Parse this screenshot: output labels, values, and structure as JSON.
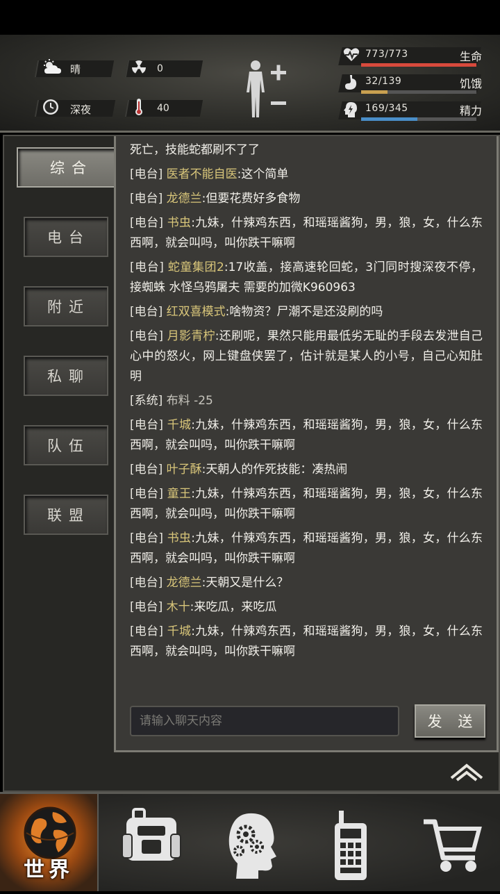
{
  "status": {
    "weather": "晴",
    "radiation": "0",
    "time_of_day": "深夜",
    "temperature": "40",
    "health": {
      "value": "773/773",
      "label": "生命",
      "ratio": 1.0,
      "color": "#d84a3c"
    },
    "hunger": {
      "value": "32/139",
      "label": "饥饿",
      "ratio": 0.23,
      "color": "#c8a050"
    },
    "energy": {
      "value": "169/345",
      "label": "精力",
      "ratio": 0.49,
      "color": "#4a8ec8"
    }
  },
  "tabs": [
    {
      "label": "综合",
      "active": true
    },
    {
      "label": "电台",
      "active": false
    },
    {
      "label": "附近",
      "active": false
    },
    {
      "label": "私聊",
      "active": false
    },
    {
      "label": "队伍",
      "active": false
    },
    {
      "label": "联盟",
      "active": false
    }
  ],
  "messages": [
    {
      "tag": "",
      "author": "",
      "text": "死亡，技能蛇都刷不了了",
      "system": false
    },
    {
      "tag": "[电台]",
      "author": "医者不能自医",
      "text": ":这个简单",
      "system": false
    },
    {
      "tag": "[电台]",
      "author": "龙德兰",
      "text": ":但要花费好多食物",
      "system": false
    },
    {
      "tag": "[电台]",
      "author": "书虫",
      "text": ":九妹，什辣鸡东西，和瑶瑶酱狗，男，狼，女，什么东西啊，就会叫吗，叫你跌干嘛啊",
      "system": false
    },
    {
      "tag": "[电台]",
      "author": "蛇童集团2",
      "text": ":17收盖，接高速轮回蛇，3门同时搜深夜不停，接蜘蛛 水怪乌鸦屠夫 需要的加微K960963",
      "system": false
    },
    {
      "tag": "[电台]",
      "author": "红双喜模式",
      "text": ":啥物资？尸潮不是还没刷的吗",
      "system": false
    },
    {
      "tag": "[电台]",
      "author": "月影青柠",
      "text": ":还刷呢，果然只能用最低劣无耻的手段去发泄自己心中的怒火，网上键盘侠罢了，估计就是某人的小号，自己心知肚明",
      "system": false
    },
    {
      "tag": "[系统]",
      "author": "",
      "text": "布料 -25",
      "system": true
    },
    {
      "tag": "[电台]",
      "author": "千城",
      "text": ":九妹，什辣鸡东西，和瑶瑶酱狗，男，狼，女，什么东西啊，就会叫吗，叫你跌干嘛啊",
      "system": false
    },
    {
      "tag": "[电台]",
      "author": "叶子酥",
      "text": ":天朝人的作死技能：凑热闹",
      "system": false
    },
    {
      "tag": "[电台]",
      "author": "童王",
      "text": ":九妹，什辣鸡东西，和瑶瑶酱狗，男，狼，女，什么东西啊，就会叫吗，叫你跌干嘛啊",
      "system": false
    },
    {
      "tag": "[电台]",
      "author": "书虫",
      "text": ":九妹，什辣鸡东西，和瑶瑶酱狗，男，狼，女，什么东西啊，就会叫吗，叫你跌干嘛啊",
      "system": false
    },
    {
      "tag": "[电台]",
      "author": "龙德兰",
      "text": ":天朝又是什么？",
      "system": false
    },
    {
      "tag": "[电台]",
      "author": "木十",
      "text": ":来吃瓜，来吃瓜",
      "system": false
    },
    {
      "tag": "[电台]",
      "author": "千城",
      "text": ":九妹，什辣鸡东西，和瑶瑶酱狗，男，狼，女，什么东西啊，就会叫吗，叫你跌干嘛啊",
      "system": false
    }
  ],
  "chat": {
    "placeholder": "请输入聊天内容",
    "send_label": "发 送"
  },
  "nav": {
    "world_label": "世界"
  },
  "icons": {
    "weather": "sun-cloud-icon",
    "radiation": "radiation-icon",
    "time": "clock-icon",
    "temperature": "thermometer-icon",
    "health": "heart-pulse-icon",
    "hunger": "stomach-icon",
    "energy": "head-energy-icon"
  }
}
